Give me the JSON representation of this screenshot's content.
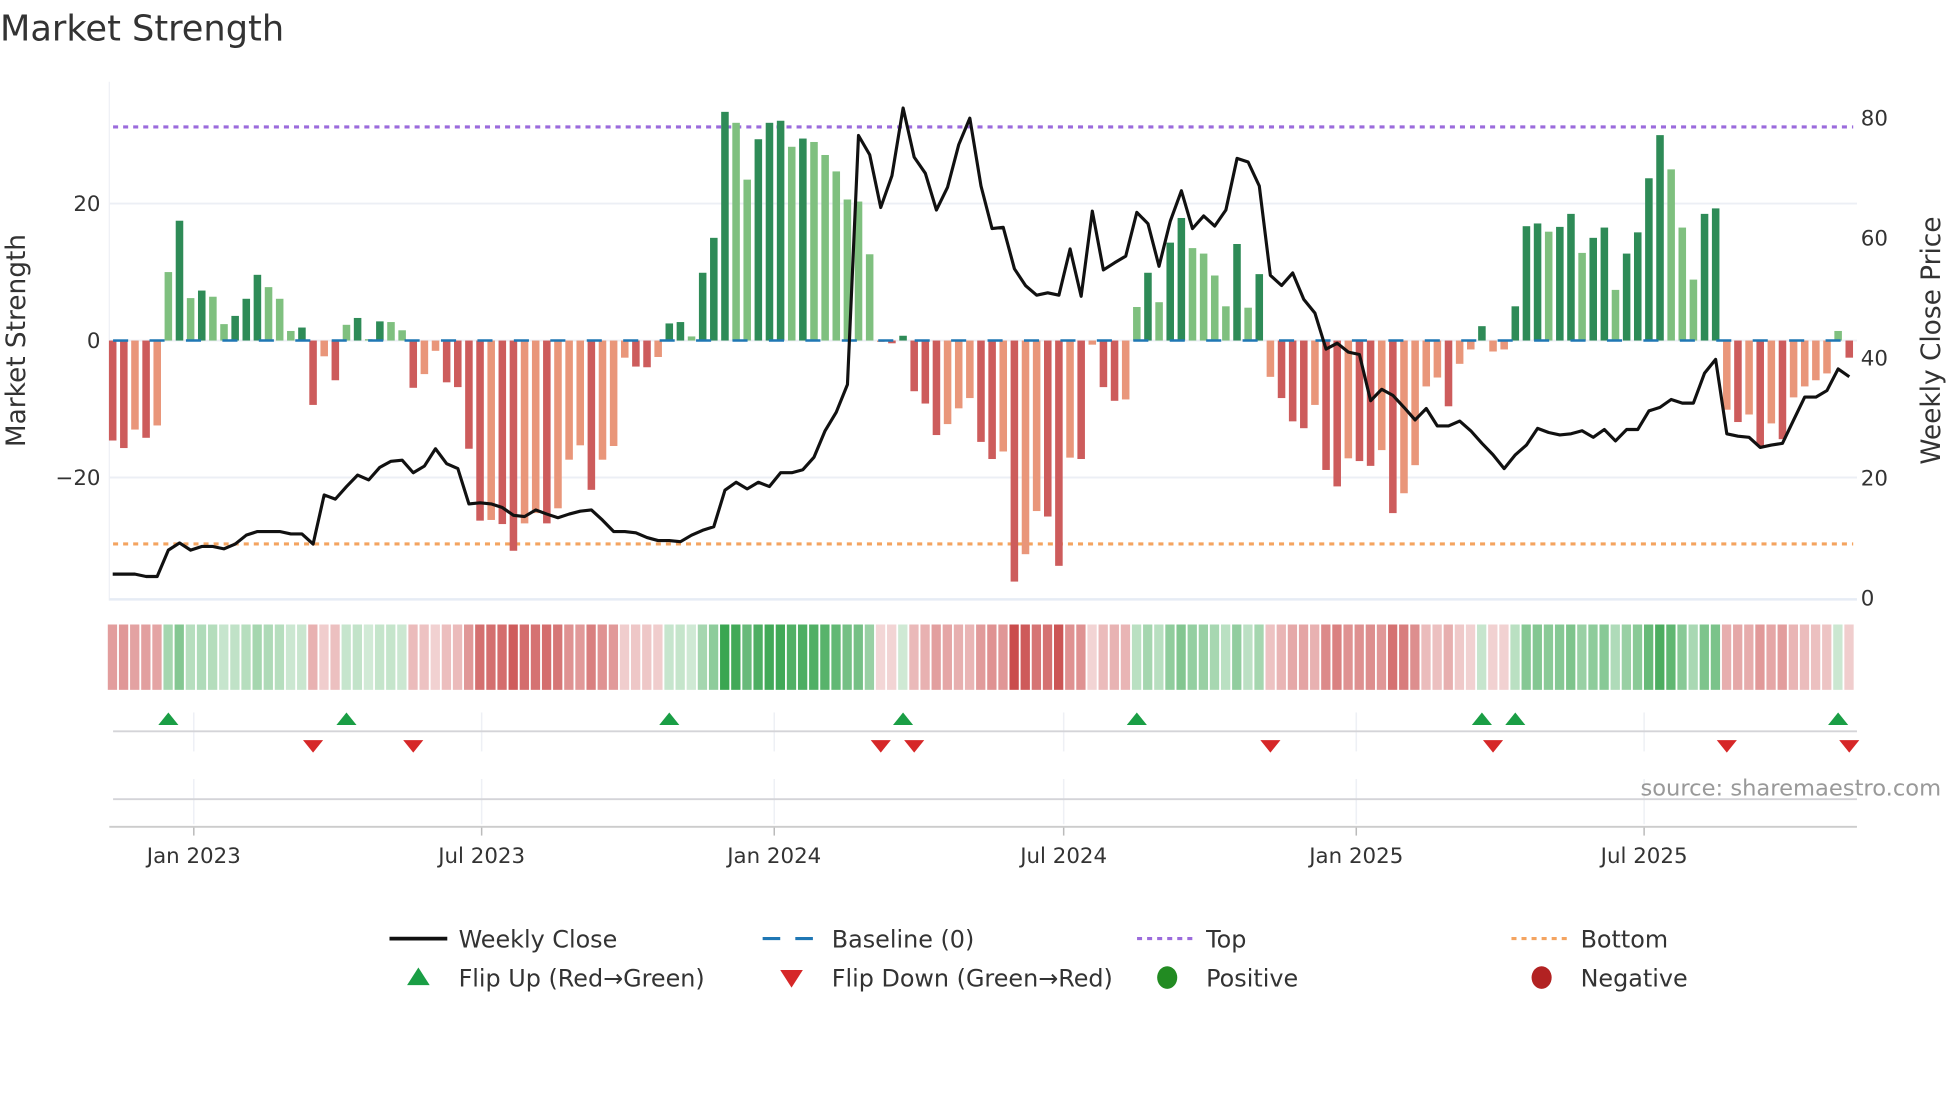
{
  "chart_data": {
    "type": "bar",
    "title": "Market Strength",
    "ylabel": "Market Strength",
    "y2label": "Weekly Close Price",
    "ylim": [
      -37.5,
      38.5
    ],
    "y2lim": [
      0,
      84
    ],
    "yticks": [
      {
        "v": 20,
        "label": "20"
      },
      {
        "v": 0,
        "label": "0"
      },
      {
        "v": -20,
        "label": "−20"
      }
    ],
    "y2ticks": [
      {
        "v": 80,
        "label": "80"
      },
      {
        "v": 60,
        "label": "60"
      },
      {
        "v": 40,
        "label": "40"
      },
      {
        "v": 20,
        "label": "20"
      },
      {
        "v": 0,
        "label": "0"
      }
    ],
    "x_start": "2022-11-11",
    "x_step_days": 7,
    "xticks": [
      {
        "date": "2023-01-01",
        "label": "Jan 2023"
      },
      {
        "date": "2023-07-01",
        "label": "Jul 2023"
      },
      {
        "date": "2024-01-01",
        "label": "Jan 2024"
      },
      {
        "date": "2024-07-01",
        "label": "Jul 2024"
      },
      {
        "date": "2025-01-01",
        "label": "Jan 2025"
      },
      {
        "date": "2025-07-01",
        "label": "Jul 2025"
      }
    ],
    "top_level": 31.2,
    "bottom_level": -29.7,
    "strength": [
      -14.6,
      -15.7,
      -13.0,
      -14.2,
      -12.4,
      10.0,
      17.5,
      6.2,
      7.3,
      6.4,
      2.4,
      3.6,
      6.1,
      9.6,
      7.8,
      6.1,
      1.4,
      1.9,
      -9.4,
      -2.3,
      -5.8,
      2.3,
      3.3,
      0.2,
      2.8,
      2.7,
      1.5,
      -6.9,
      -4.9,
      -1.5,
      -6.1,
      -6.8,
      -15.8,
      -26.3,
      -26.2,
      -26.8,
      -30.7,
      -26.7,
      -25.2,
      -26.7,
      -24.5,
      -17.4,
      -15.3,
      -21.8,
      -17.4,
      -15.4,
      -2.5,
      -3.8,
      -3.9,
      -2.4,
      2.5,
      2.7,
      0.6,
      9.9,
      15.0,
      33.4,
      31.8,
      23.5,
      29.4,
      31.8,
      32.1,
      28.3,
      29.5,
      29.0,
      27.1,
      24.7,
      20.6,
      20.3,
      12.6,
      -0.2,
      -0.4,
      0.7,
      -7.4,
      -9.2,
      -13.8,
      -12.2,
      -9.9,
      -8.4,
      -14.8,
      -17.3,
      -16.2,
      -35.2,
      -31.2,
      -24.9,
      -25.7,
      -32.9,
      -17.1,
      -17.3,
      -0.6,
      -6.8,
      -8.8,
      -8.6,
      4.9,
      9.9,
      5.6,
      14.3,
      17.9,
      13.5,
      12.7,
      9.5,
      5.0,
      14.1,
      4.8,
      9.7,
      -5.3,
      -8.4,
      -11.8,
      -12.8,
      -9.4,
      -18.9,
      -21.3,
      -17.2,
      -17.6,
      -18.3,
      -16.0,
      -25.2,
      -22.3,
      -18.2,
      -6.7,
      -5.4,
      -9.6,
      -3.4,
      -1.3,
      2.1,
      -1.6,
      -1.3,
      5.0,
      16.7,
      17.1,
      15.9,
      16.6,
      18.5,
      12.8,
      15.0,
      16.5,
      7.4,
      12.7,
      15.8,
      23.7,
      30.0,
      25.0,
      16.5,
      8.9,
      18.5,
      19.3,
      -10.1,
      -11.9,
      -10.8,
      -15.4,
      -12.1,
      -14.4,
      -8.3,
      -6.7,
      -5.8,
      -4.8,
      1.4,
      -2.5
    ],
    "weekly_close": [
      4.0,
      4.0,
      4.0,
      3.6,
      3.6,
      8.0,
      9.2,
      8.0,
      8.6,
      8.6,
      8.2,
      9.0,
      10.5,
      11.1,
      11.1,
      11.1,
      10.7,
      10.7,
      9.0,
      17.2,
      16.5,
      18.6,
      20.5,
      19.7,
      21.8,
      22.8,
      23.0,
      20.9,
      22.0,
      24.9,
      22.4,
      21.6,
      15.7,
      15.9,
      15.7,
      15.1,
      13.8,
      13.6,
      14.7,
      14.0,
      13.4,
      14.0,
      14.5,
      14.7,
      13.0,
      11.1,
      11.1,
      10.9,
      10.1,
      9.6,
      9.6,
      9.4,
      10.5,
      11.3,
      11.9,
      18.0,
      19.3,
      18.2,
      19.3,
      18.6,
      20.9,
      20.9,
      21.4,
      23.5,
      27.9,
      31.0,
      35.6,
      77.1,
      73.9,
      65.1,
      70.4,
      81.7,
      73.5,
      70.8,
      64.7,
      68.5,
      75.6,
      80.0,
      68.7,
      61.6,
      61.8,
      54.9,
      52.1,
      50.5,
      50.9,
      50.5,
      58.2,
      50.3,
      64.5,
      54.7,
      55.9,
      57.0,
      64.3,
      62.4,
      55.3,
      62.8,
      67.9,
      61.6,
      63.7,
      62.0,
      64.7,
      73.3,
      72.7,
      68.7,
      53.8,
      52.1,
      54.2,
      49.8,
      47.5,
      41.5,
      42.5,
      41.0,
      40.6,
      32.9,
      34.8,
      33.8,
      31.8,
      29.7,
      31.6,
      28.7,
      28.7,
      29.5,
      27.9,
      25.8,
      23.9,
      21.6,
      23.9,
      25.5,
      28.3,
      27.6,
      27.2,
      27.4,
      27.9,
      26.8,
      28.1,
      26.2,
      28.1,
      28.1,
      31.2,
      31.8,
      33.1,
      32.5,
      32.5,
      37.5,
      39.8,
      27.4,
      27.0,
      26.8,
      25.1,
      25.5,
      25.8,
      29.7,
      33.5,
      33.5,
      34.6,
      38.2,
      36.9
    ],
    "flip_up_weeks": [
      5,
      21,
      50,
      71,
      92,
      123,
      126,
      155
    ],
    "flip_down_weeks": [
      18,
      27,
      69,
      72,
      104,
      124,
      145,
      156
    ],
    "legend": [
      {
        "label": "Weekly Close",
        "kind": "line"
      },
      {
        "label": "Baseline (0)",
        "kind": "dash"
      },
      {
        "label": "Top",
        "kind": "dot-top"
      },
      {
        "label": "Bottom",
        "kind": "dot-bottom"
      },
      {
        "label": "Flip Up (Red→Green)",
        "kind": "up"
      },
      {
        "label": "Flip Down (Green→Red)",
        "kind": "down"
      },
      {
        "label": "Positive",
        "kind": "pos"
      },
      {
        "label": "Negative",
        "kind": "neg"
      }
    ],
    "legend_placement": "bottom",
    "source": "source: sharemaestro.com"
  },
  "colors": {
    "green_strong": "#2e8b57",
    "green_weak": "#7fc07f",
    "red_strong": "#cd5c5c",
    "red_weak": "#e9967a",
    "baseline": "#1f77b4",
    "top": "#9b6bdc",
    "bottom": "#f4a460",
    "price": "#111111",
    "flip_up": "#1a9e45",
    "flip_down": "#d62728",
    "positive": "#228b22",
    "negative": "#b22222"
  }
}
